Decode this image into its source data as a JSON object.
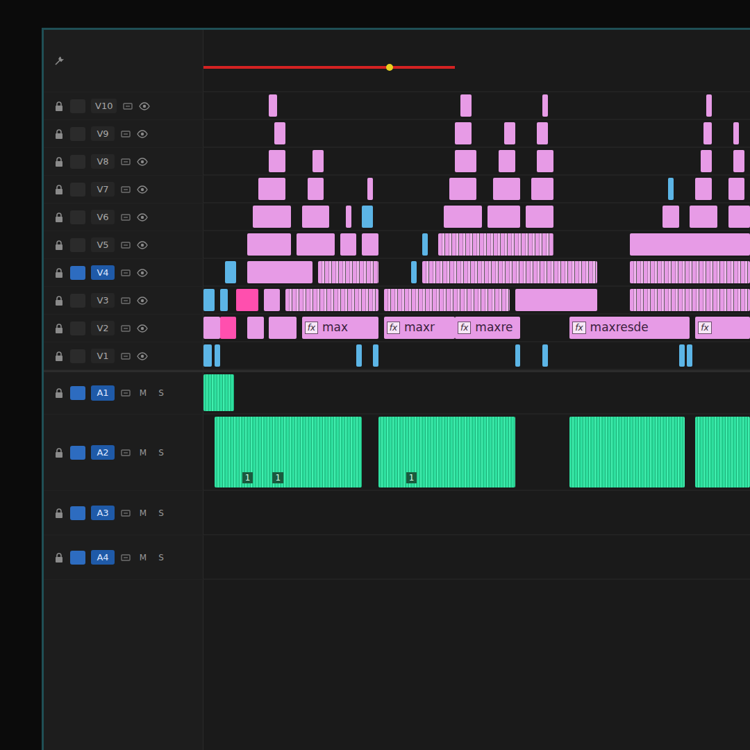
{
  "timeline": {
    "work_area": {
      "start": 0,
      "end": 46
    },
    "playhead": 34
  },
  "tracks": [
    {
      "label": "V10",
      "kind": "video",
      "targeted": false,
      "clips": [
        {
          "start": 12,
          "end": 13.5,
          "kind": "video"
        },
        {
          "start": 47,
          "end": 49,
          "kind": "video"
        },
        {
          "start": 62,
          "end": 63,
          "kind": "video"
        },
        {
          "start": 92,
          "end": 93,
          "kind": "video"
        }
      ]
    },
    {
      "label": "V9",
      "kind": "video",
      "targeted": false,
      "clips": [
        {
          "start": 13,
          "end": 15,
          "kind": "video"
        },
        {
          "start": 46,
          "end": 49,
          "kind": "video"
        },
        {
          "start": 55,
          "end": 57,
          "kind": "video"
        },
        {
          "start": 61,
          "end": 63,
          "kind": "video"
        },
        {
          "start": 91.5,
          "end": 93,
          "kind": "video"
        },
        {
          "start": 97,
          "end": 98,
          "kind": "video"
        }
      ]
    },
    {
      "label": "V8",
      "kind": "video",
      "targeted": false,
      "clips": [
        {
          "start": 12,
          "end": 15,
          "kind": "video"
        },
        {
          "start": 20,
          "end": 22,
          "kind": "video"
        },
        {
          "start": 46,
          "end": 50,
          "kind": "video"
        },
        {
          "start": 54,
          "end": 57,
          "kind": "video"
        },
        {
          "start": 61,
          "end": 64,
          "kind": "video"
        },
        {
          "start": 91,
          "end": 93,
          "kind": "video"
        },
        {
          "start": 97,
          "end": 99,
          "kind": "video"
        }
      ]
    },
    {
      "label": "V7",
      "kind": "video",
      "targeted": false,
      "clips": [
        {
          "start": 10,
          "end": 15,
          "kind": "video"
        },
        {
          "start": 19,
          "end": 22,
          "kind": "video"
        },
        {
          "start": 30,
          "end": 31,
          "kind": "video"
        },
        {
          "start": 45,
          "end": 50,
          "kind": "video"
        },
        {
          "start": 53,
          "end": 58,
          "kind": "video"
        },
        {
          "start": 60,
          "end": 64,
          "kind": "video"
        },
        {
          "start": 85,
          "end": 86,
          "kind": "adjust"
        },
        {
          "start": 90,
          "end": 93,
          "kind": "video"
        },
        {
          "start": 96,
          "end": 99,
          "kind": "video"
        }
      ]
    },
    {
      "label": "V6",
      "kind": "video",
      "targeted": false,
      "clips": [
        {
          "start": 9,
          "end": 16,
          "kind": "video"
        },
        {
          "start": 18,
          "end": 23,
          "kind": "video"
        },
        {
          "start": 26,
          "end": 27,
          "kind": "video"
        },
        {
          "start": 29,
          "end": 31,
          "kind": "adjust"
        },
        {
          "start": 44,
          "end": 51,
          "kind": "video"
        },
        {
          "start": 52,
          "end": 58,
          "kind": "video"
        },
        {
          "start": 59,
          "end": 64,
          "kind": "video"
        },
        {
          "start": 84,
          "end": 87,
          "kind": "video"
        },
        {
          "start": 89,
          "end": 94,
          "kind": "video"
        },
        {
          "start": 96,
          "end": 100,
          "kind": "video"
        }
      ]
    },
    {
      "label": "V5",
      "kind": "video",
      "targeted": false,
      "clips": [
        {
          "start": 8,
          "end": 16,
          "kind": "video"
        },
        {
          "start": 17,
          "end": 24,
          "kind": "video"
        },
        {
          "start": 25,
          "end": 28,
          "kind": "video"
        },
        {
          "start": 29,
          "end": 32,
          "kind": "video"
        },
        {
          "start": 40,
          "end": 41,
          "kind": "adjust"
        },
        {
          "start": 43,
          "end": 64,
          "kind": "dense"
        },
        {
          "start": 78,
          "end": 100,
          "kind": "video"
        }
      ]
    },
    {
      "label": "V4",
      "kind": "video",
      "targeted": true,
      "clips": [
        {
          "start": 4,
          "end": 6,
          "kind": "adjust"
        },
        {
          "start": 8,
          "end": 20,
          "kind": "video"
        },
        {
          "start": 21,
          "end": 32,
          "kind": "dense"
        },
        {
          "start": 38,
          "end": 39,
          "kind": "adjust"
        },
        {
          "start": 40,
          "end": 72,
          "kind": "dense"
        },
        {
          "start": 78,
          "end": 100,
          "kind": "dense"
        }
      ]
    },
    {
      "label": "V3",
      "kind": "video",
      "targeted": false,
      "clips": [
        {
          "start": 0,
          "end": 2,
          "kind": "adjust"
        },
        {
          "start": 3,
          "end": 4.5,
          "kind": "adjust"
        },
        {
          "start": 6,
          "end": 10,
          "kind": "hot"
        },
        {
          "start": 11,
          "end": 14,
          "kind": "video"
        },
        {
          "start": 15,
          "end": 32,
          "kind": "dense"
        },
        {
          "start": 33,
          "end": 56,
          "kind": "dense"
        },
        {
          "start": 57,
          "end": 72,
          "kind": "video"
        },
        {
          "start": 78,
          "end": 100,
          "kind": "dense"
        }
      ]
    },
    {
      "label": "V2",
      "kind": "video",
      "targeted": false,
      "clips": [
        {
          "start": 0,
          "end": 3,
          "kind": "video"
        },
        {
          "start": 3,
          "end": 6,
          "kind": "hot"
        },
        {
          "start": 8,
          "end": 11,
          "kind": "video"
        },
        {
          "start": 12,
          "end": 17,
          "kind": "video"
        },
        {
          "start": 18,
          "end": 32,
          "kind": "video",
          "badge": "fx",
          "label": "max"
        },
        {
          "start": 33,
          "end": 46,
          "kind": "video",
          "badge": "fx",
          "label": "maxr"
        },
        {
          "start": 46,
          "end": 58,
          "kind": "video",
          "badge": "fx",
          "label": "maxre"
        },
        {
          "start": 67,
          "end": 89,
          "kind": "video",
          "badge": "fx",
          "label": "maxresde"
        },
        {
          "start": 90,
          "end": 100,
          "kind": "video",
          "badge": "fx",
          "label": ""
        }
      ]
    },
    {
      "label": "V1",
      "kind": "video",
      "targeted": false,
      "clips": [
        {
          "start": 0,
          "end": 1.5,
          "kind": "adjust"
        },
        {
          "start": 2,
          "end": 3,
          "kind": "adjust"
        },
        {
          "start": 28,
          "end": 29,
          "kind": "adjust"
        },
        {
          "start": 31,
          "end": 32,
          "kind": "adjust"
        },
        {
          "start": 57,
          "end": 58,
          "kind": "adjust"
        },
        {
          "start": 62,
          "end": 63,
          "kind": "adjust"
        },
        {
          "start": 87,
          "end": 88,
          "kind": "adjust"
        },
        {
          "start": 88.5,
          "end": 89.5,
          "kind": "adjust"
        }
      ]
    },
    {
      "label": "A1",
      "kind": "audio",
      "targeted": true,
      "buttons": [
        "M",
        "S"
      ],
      "clips": [
        {
          "start": 0,
          "end": 2.5,
          "kind": "audio",
          "markers": []
        }
      ]
    },
    {
      "label": "A2",
      "kind": "audio",
      "targeted": true,
      "buttons": [
        "M",
        "S"
      ],
      "clips": [
        {
          "start": 2,
          "end": 29,
          "kind": "audio",
          "markers": [
            "1",
            "1"
          ]
        },
        {
          "start": 32,
          "end": 57,
          "kind": "audio",
          "markers": [
            "1"
          ]
        },
        {
          "start": 67,
          "end": 88,
          "kind": "audio",
          "markers": []
        },
        {
          "start": 90,
          "end": 100,
          "kind": "audio",
          "markers": []
        }
      ]
    },
    {
      "label": "A3",
      "kind": "audio",
      "targeted": true,
      "buttons": [
        "M",
        "S"
      ],
      "clips": []
    },
    {
      "label": "A4",
      "kind": "audio",
      "targeted": true,
      "buttons": [
        "M",
        "S"
      ],
      "clips": []
    }
  ]
}
